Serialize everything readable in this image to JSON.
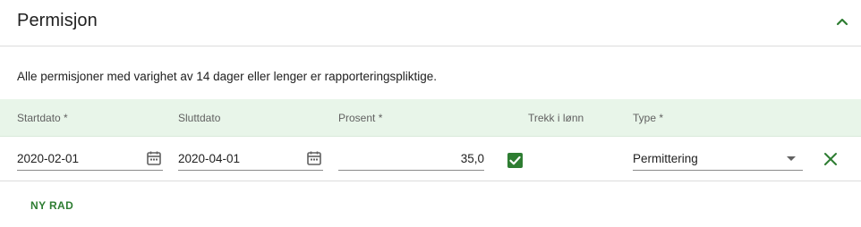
{
  "section": {
    "title": "Permisjon",
    "collapse_icon": "chevron-up-icon",
    "info_text": "Alle permisjoner med varighet av 14 dager eller lenger er rapporteringspliktige."
  },
  "table": {
    "headers": {
      "start": "Startdato *",
      "end": "Sluttdato",
      "percent": "Prosent *",
      "deduction": "Trekk i lønn",
      "type": "Type *"
    },
    "rows": [
      {
        "start_date": "2020-02-01",
        "end_date": "2020-04-01",
        "percent": "35,0",
        "deduction_checked": true,
        "type": "Permittering"
      }
    ]
  },
  "actions": {
    "add_row_label": "NY RAD",
    "remove_icon": "close-icon"
  },
  "colors": {
    "accent": "#2e7d32",
    "header_bg": "#e8f5e9"
  }
}
